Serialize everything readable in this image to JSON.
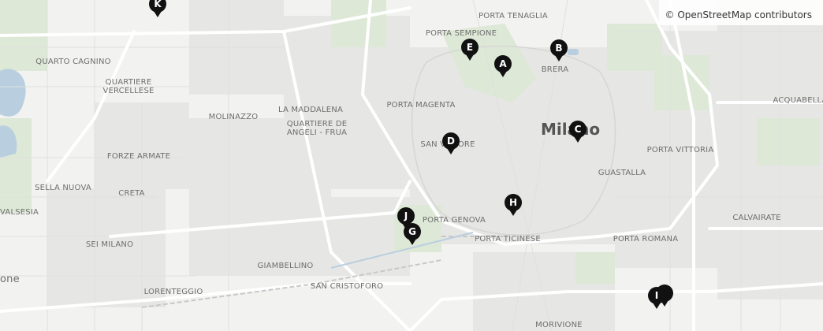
{
  "attribution": "© OpenStreetMap contributors",
  "labels": {
    "porta_tenaglia": "PORTA TENAGLIA",
    "porta_sempione": "PORTA SEMPIONE",
    "brera": "BRERA",
    "quarto_cagnino": "QUARTO CAGNINO",
    "quartiere_vercellese_1": "QUARTIERE",
    "quartiere_vercellese_2": "VERCELLESE",
    "porta_magenta": "PORTA MAGENTA",
    "la_maddalena": "LA MADDALENA",
    "molinazzo": "MOLINAZZO",
    "quartiere_de_angeli_1": "QUARTIERE DE",
    "quartiere_de_angeli_2": "ANGELI - FRUA",
    "acquabella": "ACQUABELLA",
    "milano": "Milano",
    "porta_vittoria": "PORTA VITTORIA",
    "san_vittore": "SAN VITTORE",
    "forze_armate": "FORZE ARMATE",
    "guastalla": "GUASTALLA",
    "sella_nuova": "SELLA NUOVA",
    "creta": "CRETA",
    "valsesia": "VALSESIA",
    "porta_genova": "PORTA GENOVA",
    "calvairate": "CALVAIRATE",
    "porta_ticinese": "PORTA TICINESE",
    "porta_romana": "PORTA ROMANA",
    "sei_milano": "SEI MILANO",
    "giambellino": "GIAMBELLINO",
    "lorenteggio": "LORENTEGGIO",
    "san_cristoforo": "SAN CRISTOFORO",
    "morivione": "MORIVIONE",
    "one": "one"
  },
  "markers": [
    {
      "letter": "K"
    },
    {
      "letter": "E"
    },
    {
      "letter": "A"
    },
    {
      "letter": "B"
    },
    {
      "letter": "C"
    },
    {
      "letter": "D"
    },
    {
      "letter": "H"
    },
    {
      "letter": "J"
    },
    {
      "letter": "G"
    },
    {
      "letter": "I"
    }
  ],
  "colors": {
    "background": "#f2f2f0",
    "park": "#dde8d6",
    "water": "#b9cfe0",
    "road_major": "#ffffff",
    "road_minor": "#e3e3e3",
    "block": "#e6e6e4",
    "marker": "#111111",
    "marker_text": "#ffffff"
  }
}
